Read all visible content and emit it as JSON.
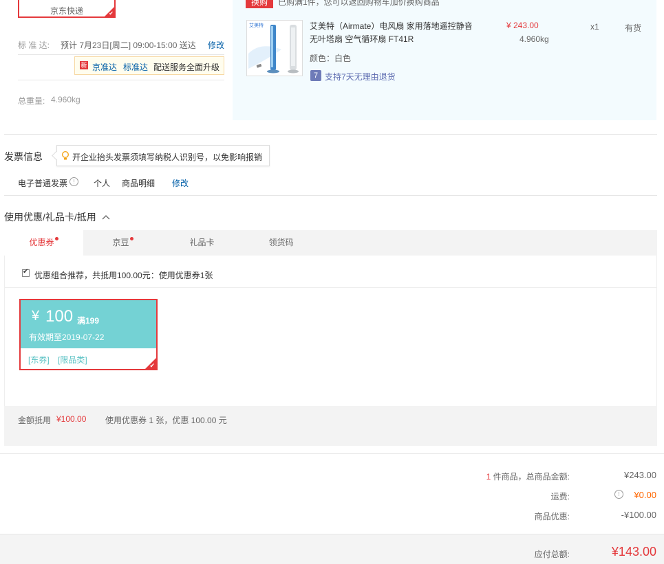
{
  "shipping": {
    "method_label": "京东快递",
    "standard_label": "标 准 达:",
    "standard_value": "预计 7月23日[周二] 09:00-15:00 送达",
    "modify": "修改",
    "promo_new": "新",
    "promo_a": "京准达",
    "promo_b": "标准达",
    "promo_text": "配送服务全面升级",
    "weight_label": "总重量:",
    "weight_value": "4.960kg"
  },
  "product": {
    "swap_badge": "换购",
    "swap_text": "已购满1件，您可以返回购物车加价换购商品",
    "thumb_brand": "艾美特",
    "name_line1": "艾美特（Airmate）电风扇 家用落地遥控静音",
    "name_line2": "无叶塔扇 空气循环扇 FT41R",
    "color": "颜色：白色",
    "return_icon": "7",
    "return_text": "支持7天无理由退货",
    "price": "¥ 243.00",
    "weight": "4.960kg",
    "qty": "x1",
    "stock": "有货"
  },
  "invoice": {
    "title": "发票信息",
    "tip": "开企业抬头发票须填写纳税人识别号，以免影响报销",
    "type": "电子普通发票",
    "holder": "个人",
    "content": "商品明细",
    "modify": "修改"
  },
  "discount": {
    "title": "使用优惠/礼品卡/抵用",
    "tabs": [
      {
        "label": "优惠券",
        "dot": true
      },
      {
        "label": "京豆",
        "dot": true
      },
      {
        "label": "礼品卡",
        "dot": false
      },
      {
        "label": "领货码",
        "dot": false
      }
    ],
    "combo_text": "优惠组合推荐，共抵用100.00元：使用优惠券1张",
    "coupon": {
      "currency": "¥",
      "amount": "100",
      "threshold": "满199",
      "valid": "有效期至2019-07-22",
      "tag1": "[东券]",
      "tag2": "[限品类]"
    },
    "summary_label": "金额抵用",
    "summary_amount": "¥100.00",
    "summary_detail": "使用优惠券 1 张，优惠 100.00 元"
  },
  "totals": {
    "count": "1",
    "count_label": "件商品，总商品金额:",
    "goods_amount": "¥243.00",
    "freight_label": "运费:",
    "freight_amount": "¥0.00",
    "discount_label": "商品优惠:",
    "discount_amount": "-¥100.00",
    "payable_label": "应付总额:",
    "payable_amount": "¥143.00"
  }
}
